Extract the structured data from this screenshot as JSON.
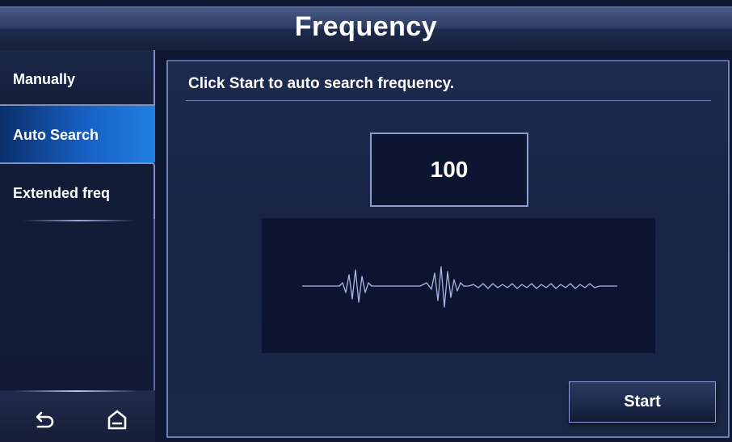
{
  "header": {
    "title": "Frequency"
  },
  "sidebar": {
    "items": [
      {
        "label": "Manually",
        "active": false
      },
      {
        "label": "Auto Search",
        "active": true
      },
      {
        "label": "Extended freq",
        "active": false
      }
    ]
  },
  "navbar": {
    "back_icon": "back-arrow-icon",
    "home_icon": "home-icon"
  },
  "main": {
    "instruction": "Click Start to auto search frequency.",
    "frequency_value": "100",
    "start_label": "Start"
  },
  "colors": {
    "background": "#0d1830",
    "active_tab": "#1760c3",
    "accent_border": "#8d9dd0",
    "waveform": "#a9b6e8"
  }
}
